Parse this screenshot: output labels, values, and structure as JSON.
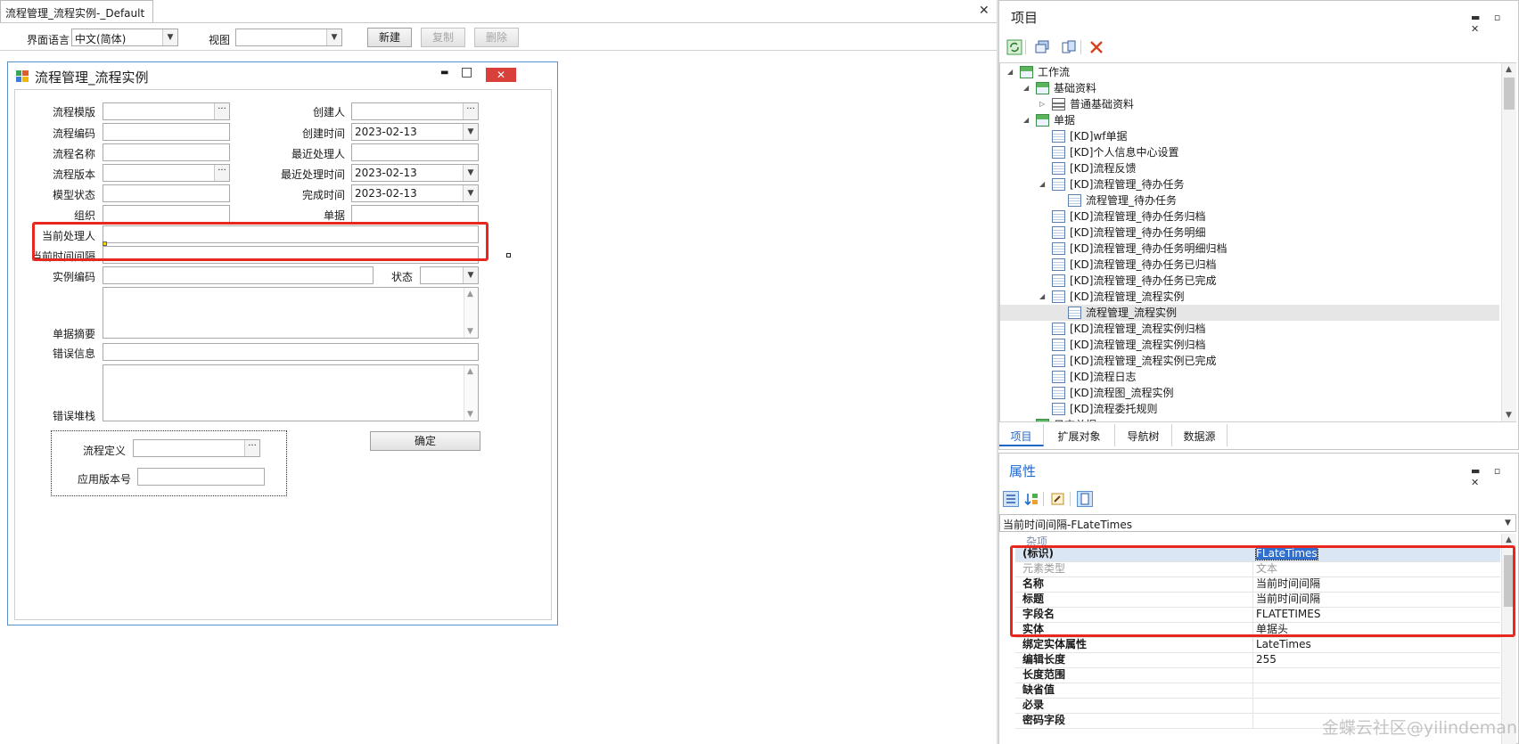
{
  "document_tab": {
    "title": "流程管理_流程实例-_Default",
    "close": "✕"
  },
  "toolbar": {
    "language_label": "界面语言",
    "language_value": "中文(简体)",
    "view_label": "视图",
    "view_value": "",
    "new_label": "新建",
    "copy_label": "复制",
    "delete_label": "删除"
  },
  "form_window": {
    "title": "流程管理_流程实例",
    "controls": {
      "minimize": "▬",
      "maximize": "□",
      "close": "✕"
    },
    "fields": {
      "template": {
        "label": "流程模版",
        "value": ""
      },
      "creator": {
        "label": "创建人",
        "value": ""
      },
      "code": {
        "label": "流程编码",
        "value": ""
      },
      "create_time": {
        "label": "创建时间",
        "value": "2023-02-13"
      },
      "name": {
        "label": "流程名称",
        "value": ""
      },
      "last_handler": {
        "label": "最近处理人",
        "value": ""
      },
      "version": {
        "label": "流程版本",
        "value": ""
      },
      "last_handle_time": {
        "label": "最近处理时间",
        "value": "2023-02-13"
      },
      "model_status": {
        "label": "模型状态",
        "value": ""
      },
      "finish_time": {
        "label": "完成时间",
        "value": "2023-02-13"
      },
      "org": {
        "label": "组织",
        "value": ""
      },
      "bill": {
        "label": "单据",
        "value": ""
      },
      "current_handler": {
        "label": "当前处理人",
        "value": ""
      },
      "current_interval": {
        "label": "当前时间间隔",
        "value": ""
      },
      "instance_code": {
        "label": "实例编码",
        "value": ""
      },
      "status": {
        "label": "状态",
        "value": ""
      },
      "summary": {
        "label": "单据摘要",
        "value": ""
      },
      "error_info": {
        "label": "错误信息",
        "value": ""
      },
      "error_stack": {
        "label": "错误堆栈",
        "value": ""
      },
      "process_def": {
        "label": "流程定义",
        "value": ""
      },
      "app_version": {
        "label": "应用版本号",
        "value": ""
      }
    },
    "ok_button": "确定",
    "ellipsis": "···"
  },
  "project_panel": {
    "title": "项目",
    "panel_controls": "▬ ▫ ✕",
    "tree": [
      {
        "label": "工作流",
        "depth": 0,
        "expanded": true,
        "icon": "workflow-icon"
      },
      {
        "label": "基础资料",
        "depth": 1,
        "expanded": true,
        "icon": "basedata-icon"
      },
      {
        "label": "普通基础资料",
        "depth": 2,
        "expanded": false,
        "icon": "basedata-item-icon"
      },
      {
        "label": "单据",
        "depth": 1,
        "expanded": true,
        "icon": "folder-icon"
      },
      {
        "label": "[KD]wf单据",
        "depth": 2,
        "icon": "form-icon"
      },
      {
        "label": "[KD]个人信息中心设置",
        "depth": 2,
        "icon": "form-icon"
      },
      {
        "label": "[KD]流程反馈",
        "depth": 2,
        "icon": "form-icon"
      },
      {
        "label": "[KD]流程管理_待办任务",
        "depth": 2,
        "expanded": true,
        "icon": "form-icon"
      },
      {
        "label": "流程管理_待办任务",
        "depth": 3,
        "icon": "form-icon"
      },
      {
        "label": "[KD]流程管理_待办任务归档",
        "depth": 2,
        "icon": "form-icon"
      },
      {
        "label": "[KD]流程管理_待办任务明细",
        "depth": 2,
        "icon": "form-icon"
      },
      {
        "label": "[KD]流程管理_待办任务明细归档",
        "depth": 2,
        "icon": "form-icon"
      },
      {
        "label": "[KD]流程管理_待办任务已归档",
        "depth": 2,
        "icon": "form-icon"
      },
      {
        "label": "[KD]流程管理_待办任务已完成",
        "depth": 2,
        "icon": "form-icon"
      },
      {
        "label": "[KD]流程管理_流程实例",
        "depth": 2,
        "expanded": true,
        "icon": "form-icon"
      },
      {
        "label": "流程管理_流程实例",
        "depth": 3,
        "selected": true,
        "icon": "form-icon"
      },
      {
        "label": "[KD]流程管理_流程实例归档",
        "depth": 2,
        "icon": "form-icon"
      },
      {
        "label": "[KD]流程管理_流程实例归档",
        "depth": 2,
        "icon": "form-icon"
      },
      {
        "label": "[KD]流程管理_流程实例已完成",
        "depth": 2,
        "icon": "form-icon"
      },
      {
        "label": "[KD]流程日志",
        "depth": 2,
        "icon": "form-icon"
      },
      {
        "label": "[KD]流程图_流程实例",
        "depth": 2,
        "icon": "form-icon"
      },
      {
        "label": "[KD]流程委托规则",
        "depth": 2,
        "icon": "form-icon"
      },
      {
        "label": "日志单据",
        "depth": 1,
        "icon": "folder-icon"
      }
    ],
    "tabs": [
      "项目",
      "扩展对象",
      "导航树",
      "数据源"
    ]
  },
  "property_panel": {
    "title": "属性",
    "panel_controls": "▬ ▫ ✕",
    "selected_object": "当前时间间隔-FLateTimes",
    "category": "杂项",
    "rows": [
      {
        "key": "(标识)",
        "value": "FLateTimes"
      },
      {
        "key": "元素类型",
        "value": "文本"
      },
      {
        "key": "名称",
        "value": "当前时间间隔"
      },
      {
        "key": "标题",
        "value": "当前时间间隔"
      },
      {
        "key": "字段名",
        "value": "FLATETIMES"
      },
      {
        "key": "实体",
        "value": "单据头"
      },
      {
        "key": "绑定实体属性",
        "value": "LateTimes"
      },
      {
        "key": "编辑长度",
        "value": "255"
      },
      {
        "key": "长度范围",
        "value": ""
      },
      {
        "key": "缺省值",
        "value": ""
      },
      {
        "key": "必录",
        "value": ""
      },
      {
        "key": "密码字段",
        "value": ""
      }
    ]
  },
  "watermark": "金蝶云社区@yilindeman",
  "colors": {
    "accent": "#1e66c9",
    "highlight_box": "#e8271f",
    "window_close": "#d9403a"
  }
}
